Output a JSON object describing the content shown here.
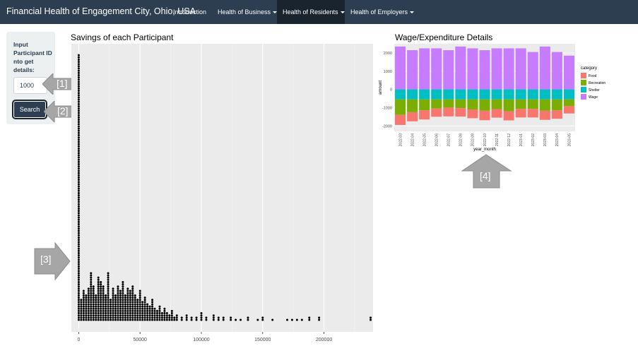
{
  "navbar": {
    "brand": "Financial Health of Engagement City, Ohio, USA",
    "items": [
      {
        "label": "Introduction",
        "dropdown": false,
        "active": false
      },
      {
        "label": "Health of Business",
        "dropdown": true,
        "active": false
      },
      {
        "label": "Health of Residents",
        "dropdown": true,
        "active": true
      },
      {
        "label": "Health of Employers",
        "dropdown": true,
        "active": false
      }
    ]
  },
  "sidebar": {
    "label": "Input Participant ID nto get details:",
    "input_value": "1000",
    "search_label": "Search"
  },
  "callouts": [
    "[1]",
    "[2]",
    "[3]",
    "[4]"
  ],
  "colors": {
    "navbar": "#2c3e50",
    "food": "#f8766d",
    "recreation": "#7cae00",
    "shelter": "#00bfc4",
    "wage": "#c77cff",
    "callout": "#a6a6a6"
  },
  "chart_data": [
    {
      "type": "scatter",
      "subtype": "dot-histogram",
      "title": "Savings of each Participant",
      "xlabel": "",
      "ylabel": "",
      "xticks": [
        "0",
        "50000",
        "100000",
        "150000",
        "200000"
      ],
      "xlim": [
        -6000,
        240000
      ],
      "bin_width": 2000,
      "grid": true,
      "legend": "none",
      "x": [
        0,
        2000,
        4000,
        6000,
        8000,
        10000,
        12000,
        14000,
        16000,
        18000,
        20000,
        22000,
        24000,
        26000,
        28000,
        30000,
        32000,
        34000,
        36000,
        38000,
        40000,
        42000,
        44000,
        46000,
        48000,
        50000,
        52000,
        54000,
        56000,
        58000,
        60000,
        62000,
        64000,
        66000,
        68000,
        70000,
        72000,
        74000,
        76000,
        78000,
        80000,
        84000,
        88000,
        92000,
        96000,
        100000,
        104000,
        110000,
        114000,
        118000,
        124000,
        128000,
        132000,
        138000,
        146000,
        150000,
        158000,
        170000,
        174000,
        178000,
        182000,
        188000,
        196000,
        238000
      ],
      "counts": [
        120,
        10,
        14,
        12,
        15,
        22,
        16,
        12,
        20,
        18,
        16,
        12,
        22,
        10,
        15,
        12,
        16,
        14,
        18,
        12,
        15,
        14,
        16,
        12,
        10,
        14,
        9,
        11,
        8,
        7,
        10,
        6,
        5,
        7,
        4,
        6,
        4,
        3,
        5,
        2,
        3,
        2,
        3,
        2,
        2,
        4,
        2,
        3,
        2,
        2,
        2,
        1,
        1,
        2,
        1,
        2,
        1,
        1,
        1,
        1,
        1,
        2,
        2,
        2
      ]
    },
    {
      "type": "bar",
      "subtype": "stacked-diverging",
      "title": "Wage/Expenditure Details",
      "xlabel": "year_month",
      "ylabel": "amount",
      "ylim": [
        -2300,
        2500
      ],
      "yticks": [
        -2000,
        -1000,
        0,
        1000,
        2000
      ],
      "legend_title": "category",
      "legend_position": "right",
      "categories": [
        "2022-03",
        "2022-04",
        "2022-05",
        "2022-06",
        "2022-07",
        "2022-08",
        "2022-09",
        "2022-10",
        "2022-11",
        "2022-12",
        "2023-01",
        "2023-02",
        "2023-03",
        "2023-04",
        "2023-05"
      ],
      "series": [
        {
          "name": "Food",
          "values": [
            -550,
            -500,
            -500,
            -450,
            -480,
            -460,
            -480,
            -520,
            -470,
            -500,
            -470,
            -470,
            -500,
            -460,
            -400
          ]
        },
        {
          "name": "Recreation",
          "values": [
            -850,
            -700,
            -600,
            -500,
            -450,
            -480,
            -550,
            -620,
            -530,
            -650,
            -520,
            -520,
            -620,
            -600,
            -370
          ]
        },
        {
          "name": "Shelter",
          "values": [
            -550,
            -550,
            -550,
            -550,
            -550,
            -550,
            -550,
            -550,
            -550,
            -550,
            -550,
            -550,
            -550,
            -550,
            -550
          ]
        },
        {
          "name": "Wage",
          "values": [
            2350,
            2150,
            2250,
            2250,
            2150,
            2350,
            2250,
            2150,
            2250,
            2250,
            2250,
            2050,
            2350,
            2050,
            1850
          ]
        }
      ]
    }
  ]
}
